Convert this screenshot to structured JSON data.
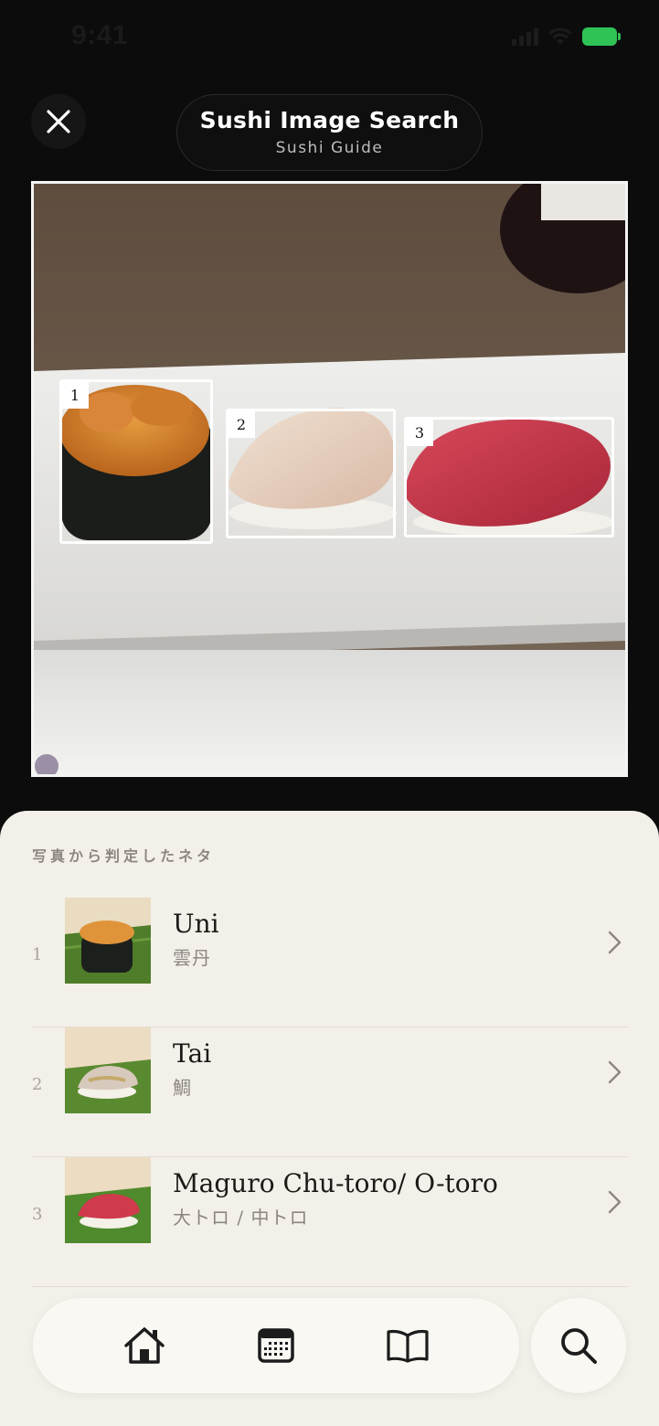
{
  "status_bar": {
    "time": "9:41"
  },
  "header": {
    "title": "Sushi Image Search",
    "subtitle": "Sushi Guide"
  },
  "photo": {
    "detections": [
      {
        "number": "1"
      },
      {
        "number": "2"
      },
      {
        "number": "3"
      }
    ]
  },
  "results": {
    "heading": "写真から判定したネタ",
    "items": [
      {
        "number": "1",
        "name": "Uni",
        "japanese": "雲丹"
      },
      {
        "number": "2",
        "name": "Tai",
        "japanese": "鯛"
      },
      {
        "number": "3",
        "name": "Maguro Chu-toro/ O-toro",
        "japanese": "大トロ / 中トロ"
      }
    ]
  },
  "tabbar": {
    "tabs": [
      {
        "icon": "home-icon"
      },
      {
        "icon": "calendar-icon"
      },
      {
        "icon": "book-icon"
      }
    ],
    "search_icon": "search-icon"
  },
  "colors": {
    "battery": "#2fc356",
    "sheet": "#f3f0ea",
    "tabbar": "#faf8f2"
  }
}
